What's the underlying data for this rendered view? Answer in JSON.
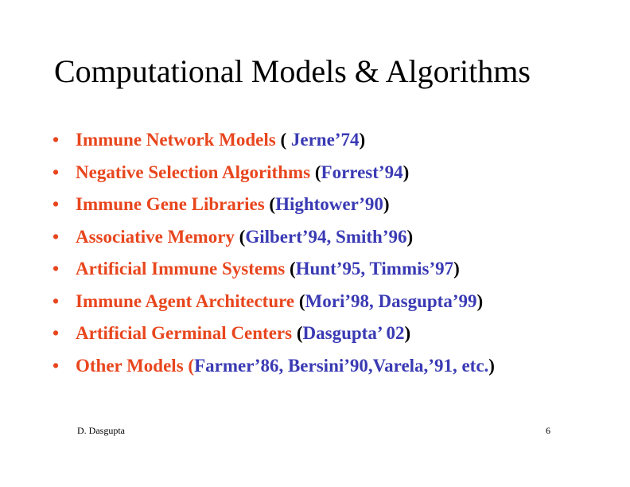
{
  "slide": {
    "title": "Computational Models & Algorithms",
    "bullet_char": "•",
    "items": [
      {
        "topic": "Immune Network Models",
        "sep": " ",
        "open": "( ",
        "ref": "Jerne’74",
        "close": ")"
      },
      {
        "topic": "Negative Selection Algorithms",
        "sep": " ",
        "open": "(",
        "ref": "Forrest’94",
        "close": ")"
      },
      {
        "topic": "Immune Gene Libraries",
        "sep": " ",
        "open": "(",
        "ref": "Hightower’90",
        "close": ")"
      },
      {
        "topic": "Associative Memory",
        "sep": " ",
        "open": "(",
        "ref": "Gilbert’94, Smith’96",
        "close": ")"
      },
      {
        "topic": "Artificial Immune Systems",
        "sep": " ",
        "open": "(",
        "ref": "Hunt’95, Timmis’97",
        "close": ")"
      },
      {
        "topic": "Immune Agent Architecture",
        "sep": " ",
        "open": "(",
        "ref": "Mori’98, Dasgupta’99",
        "close": ")"
      },
      {
        "topic": "Artificial Germinal Centers",
        "sep": " ",
        "open": "(",
        "ref": "Dasgupta’ 02",
        "close": ")"
      },
      {
        "topic": "Other Models (",
        "sep": "",
        "open": "",
        "ref": "Farmer’86, Bersini’90,Varela,’91, etc.",
        "close": ")"
      }
    ],
    "footer_author": "D. Dasgupta",
    "page_number": "6"
  },
  "colors": {
    "topic": "#e8461e",
    "reference": "#3a3ab4",
    "text": "#000000"
  }
}
